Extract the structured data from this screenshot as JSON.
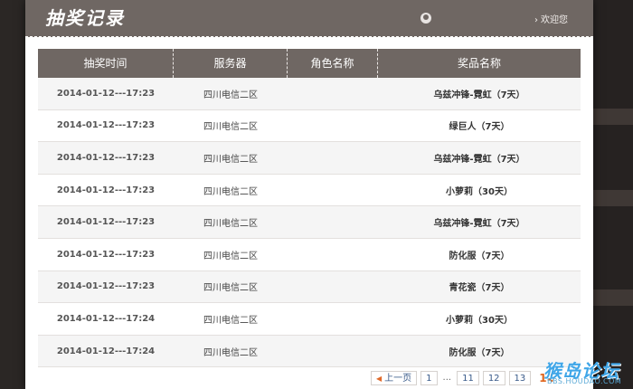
{
  "modal": {
    "title": "抽奖记录",
    "welcome": "欢迎您"
  },
  "table": {
    "headers": [
      "抽奖时间",
      "服务器",
      "角色名称",
      "奖品名称"
    ],
    "rows": [
      {
        "time": "2014-01-12---17:23",
        "server": "四川电信二区",
        "role": "",
        "prize": "乌兹冲锋-霓虹（7天）"
      },
      {
        "time": "2014-01-12---17:23",
        "server": "四川电信二区",
        "role": "",
        "prize": "绿巨人（7天）"
      },
      {
        "time": "2014-01-12---17:23",
        "server": "四川电信二区",
        "role": "",
        "prize": "乌兹冲锋-霓虹（7天）"
      },
      {
        "time": "2014-01-12---17:23",
        "server": "四川电信二区",
        "role": "",
        "prize": "小萝莉（30天）"
      },
      {
        "time": "2014-01-12---17:23",
        "server": "四川电信二区",
        "role": "",
        "prize": "乌兹冲锋-霓虹（7天）"
      },
      {
        "time": "2014-01-12---17:23",
        "server": "四川电信二区",
        "role": "",
        "prize": "防化服（7天）"
      },
      {
        "time": "2014-01-12---17:23",
        "server": "四川电信二区",
        "role": "",
        "prize": "青花瓷（7天）"
      },
      {
        "time": "2014-01-12---17:24",
        "server": "四川电信二区",
        "role": "",
        "prize": "小萝莉（30天）"
      },
      {
        "time": "2014-01-12---17:24",
        "server": "四川电信二区",
        "role": "",
        "prize": "防化服（7天）"
      }
    ]
  },
  "pager": {
    "prev": "上一页",
    "pages": [
      "1",
      "...",
      "11",
      "12",
      "13"
    ],
    "current": "14"
  },
  "watermark": {
    "text": "猴岛论坛",
    "sub": "BBS.HOUDAO.COM"
  }
}
